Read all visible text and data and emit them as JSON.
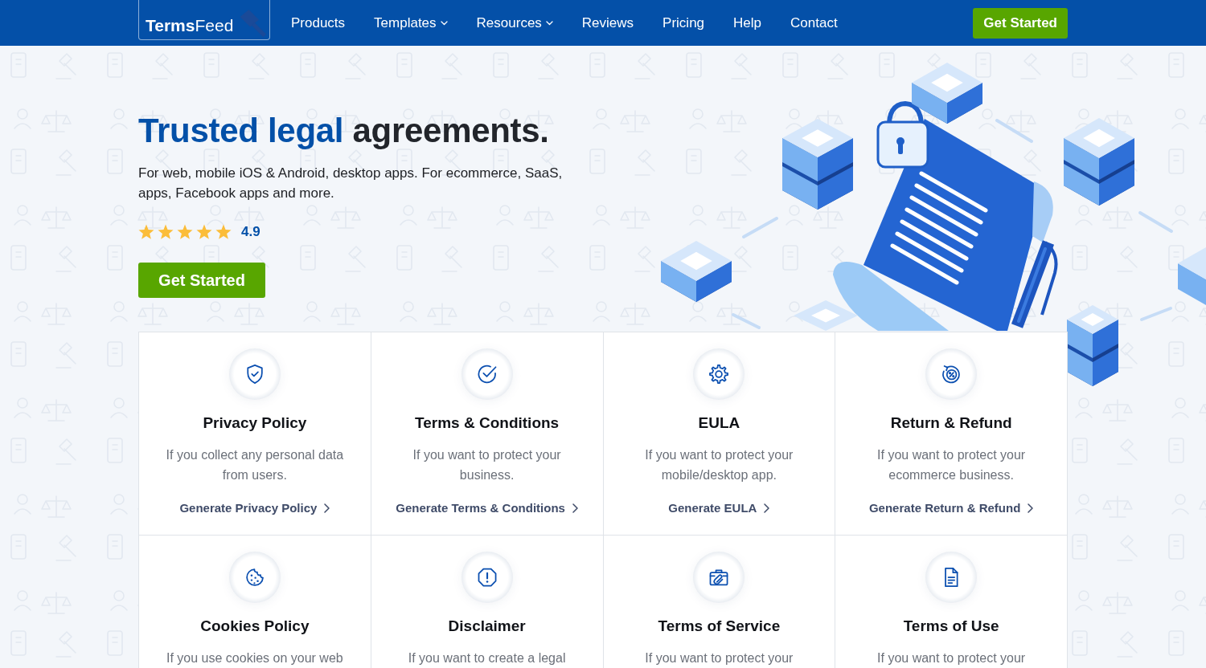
{
  "nav": {
    "logo": "**Terms**Feed",
    "items": [
      {
        "label": "Products",
        "dropdown": false
      },
      {
        "label": "Templates",
        "dropdown": true
      },
      {
        "label": "Resources",
        "dropdown": true
      },
      {
        "label": "Reviews",
        "dropdown": false
      },
      {
        "label": "Pricing",
        "dropdown": false
      },
      {
        "label": "Help",
        "dropdown": false
      },
      {
        "label": "Contact",
        "dropdown": false
      }
    ],
    "cta": "Get Started"
  },
  "hero": {
    "title_highlight": "Trusted legal",
    "title_rest": "agreements.",
    "subtitle": "For web, mobile iOS & Android, desktop apps. For ecommerce, SaaS, apps, Facebook apps and more.",
    "rating": {
      "stars": 5,
      "value": "4.9"
    },
    "cta": "Get Started"
  },
  "cards": [
    {
      "title": "Privacy Policy",
      "description": "If you collect any personal data from users.",
      "link": "Generate Privacy Policy"
    },
    {
      "title": "Terms & Conditions",
      "description": "If you want to protect your business.",
      "link": "Generate Terms & Conditions"
    },
    {
      "title": "EULA",
      "description": "If you want to protect your mobile/desktop app.",
      "link": "Generate EULA"
    },
    {
      "title": "Return & Refund",
      "description": "If you want to protect your ecommerce business.",
      "link": "Generate Return & Refund"
    },
    {
      "title": "Cookies Policy",
      "description": "If you use cookies on your web"
    },
    {
      "title": "Disclaimer",
      "description": "If you want to create a legal"
    },
    {
      "title": "Terms of Service",
      "description": "If you want to protect your"
    },
    {
      "title": "Terms of Use",
      "description": "If you want to protect your"
    }
  ]
}
